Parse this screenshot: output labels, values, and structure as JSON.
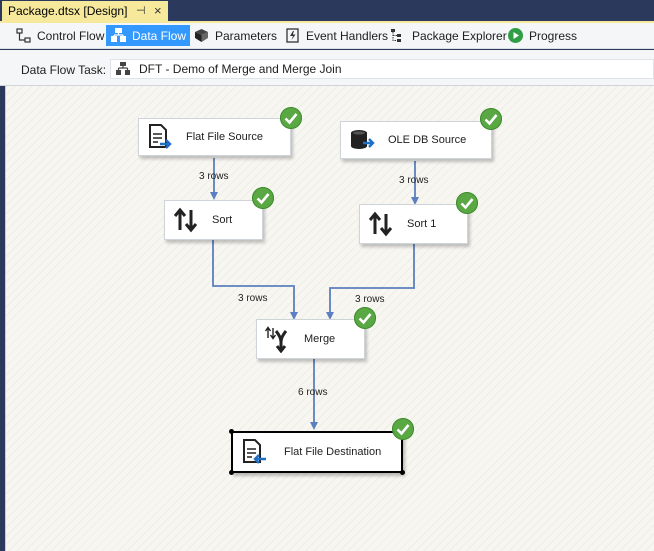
{
  "document_tab": {
    "title": "Package.dtsx [Design]",
    "pin": "⊣",
    "close": "×"
  },
  "designer_tabs": [
    {
      "label": "Control Flow",
      "icon": "control-flow-icon",
      "active": false
    },
    {
      "label": "Data Flow",
      "icon": "data-flow-icon",
      "active": true
    },
    {
      "label": "Parameters",
      "icon": "parameters-icon",
      "active": false
    },
    {
      "label": "Event Handlers",
      "icon": "event-handlers-icon",
      "active": false
    },
    {
      "label": "Package Explorer",
      "icon": "package-explorer-icon",
      "active": false
    },
    {
      "label": "Progress",
      "icon": "progress-icon",
      "active": false
    }
  ],
  "task_bar": {
    "label": "Data Flow Task:",
    "selected_task": "DFT - Demo of Merge and Merge Join"
  },
  "components": {
    "flat_file_source": {
      "label": "Flat File Source",
      "status": "success"
    },
    "ole_db_source": {
      "label": "OLE DB Source",
      "status": "success"
    },
    "sort": {
      "label": "Sort",
      "status": "success"
    },
    "sort_1": {
      "label": "Sort 1",
      "status": "success"
    },
    "merge": {
      "label": "Merge",
      "status": "success"
    },
    "flat_file_destination": {
      "label": "Flat File Destination",
      "status": "success",
      "selected": true
    }
  },
  "paths": {
    "flat_file_source_to_sort": "3 rows",
    "ole_db_source_to_sort_1": "3 rows",
    "sort_to_merge": "3 rows",
    "sort_1_to_merge": "3 rows",
    "merge_to_destination": "6 rows"
  },
  "colors": {
    "active_tab": "#3399ff",
    "document_tab": "#f6e99b",
    "success_check": "#5aa844",
    "connector": "#5b7fbf"
  }
}
